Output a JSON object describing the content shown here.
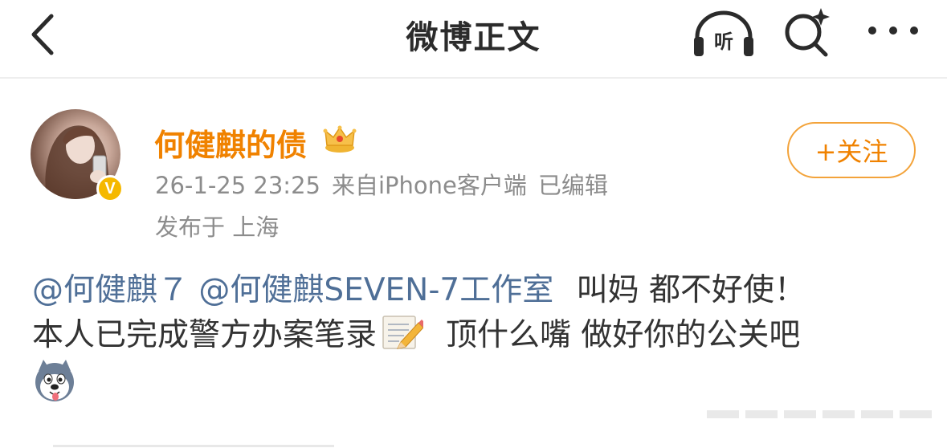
{
  "header": {
    "title": "微博正文",
    "back_icon": "chevron-left-icon",
    "listen_label": "听",
    "search_icon": "search-sparkle-icon",
    "more_icon": "more-dots-icon"
  },
  "post": {
    "author": {
      "name": "何健麒的债",
      "avatar": "avatar-image",
      "verified_icon": "v-badge-icon",
      "verified_label": "V",
      "member_icon": "crown-icon"
    },
    "timestamp": "26-1-25 23:25",
    "source": "来自iPhone客户端",
    "edited": "已编辑",
    "location": "发布于 上海",
    "follow_label": "+关注",
    "body": {
      "mention1": "@何健麒７",
      "mention2": "@何健麒SEVEN-7工作室",
      "text1": "叫妈 都不好使！",
      "text2": "本人已完成警方办案笔录",
      "emoji_note": "pencil-paper-emoji",
      "text3": "顶什么嘴 做好你的公关吧",
      "emoji_end": "husky-dog-emoji"
    }
  },
  "colors": {
    "accent": "#f08200",
    "mention": "#4f6f97",
    "meta": "#8c8c8c",
    "text": "#333333"
  }
}
